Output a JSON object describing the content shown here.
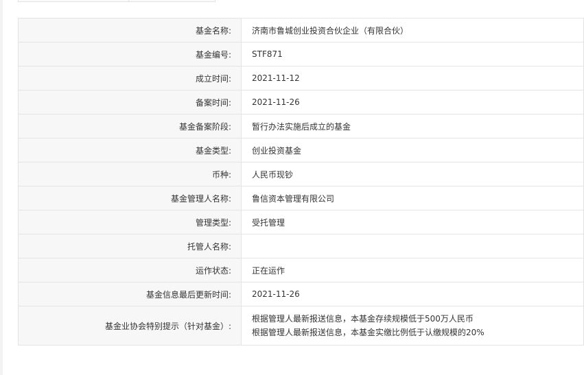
{
  "fund_info": {
    "rows": [
      {
        "label": "基金名称:",
        "value": "济南市鲁城创业投资合伙企业（有限合伙）"
      },
      {
        "label": "基金编号:",
        "value": "STF871"
      },
      {
        "label": "成立时间:",
        "value": "2021-11-12"
      },
      {
        "label": "备案时间:",
        "value": "2021-11-26"
      },
      {
        "label": "基金备案阶段:",
        "value": "暂行办法实施后成立的基金"
      },
      {
        "label": "基金类型:",
        "value": "创业投资基金"
      },
      {
        "label": "币种:",
        "value": "人民币现钞"
      },
      {
        "label": "基金管理人名称:",
        "value": "鲁信资本管理有限公司"
      },
      {
        "label": "管理类型:",
        "value": "受托管理"
      },
      {
        "label": "托管人名称:",
        "value": ""
      },
      {
        "label": "运作状态:",
        "value": "正在运作"
      },
      {
        "label": "基金信息最后更新时间:",
        "value": "2021-11-26"
      }
    ],
    "special_notice": {
      "label": "基金业协会特别提示（针对基金）:",
      "lines": [
        "根据管理人最新报送信息，本基金存续规模低于500万人民币",
        "根据管理人最新报送信息，本基金实缴比例低于认缴规模的20%"
      ]
    }
  }
}
